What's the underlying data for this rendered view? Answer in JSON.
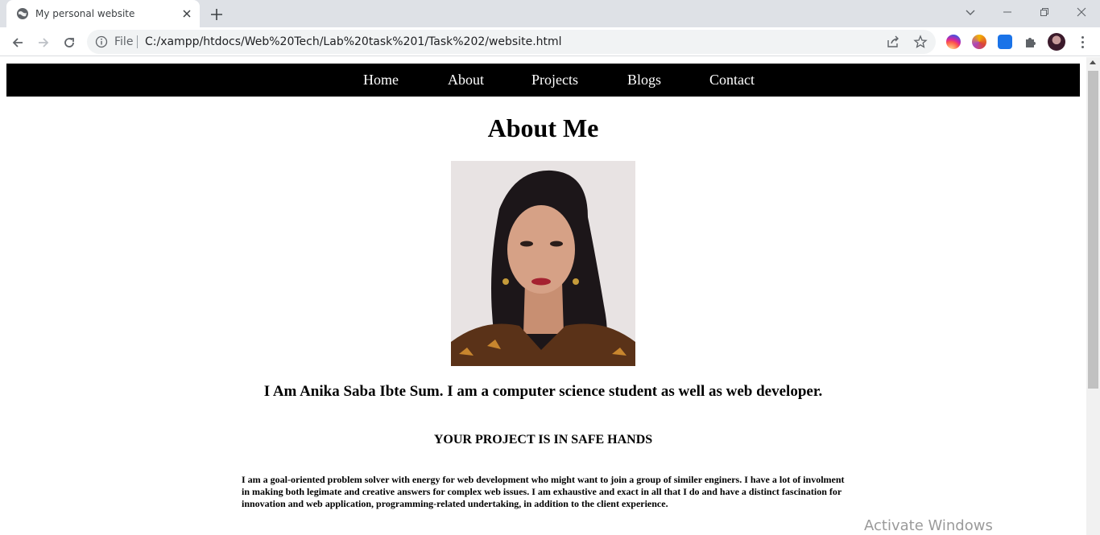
{
  "browser": {
    "tab_title": "My personal website",
    "scheme_label": "File",
    "url": "C:/xampp/htdocs/Web%20Tech/Lab%20task%201/Task%202/website.html"
  },
  "site": {
    "nav": [
      "Home",
      "About",
      "Projects",
      "Blogs",
      "Contact"
    ],
    "heading": "About Me",
    "intro": "I Am Anika Saba Ibte Sum. I am a computer science student as well as web developer.",
    "tagline": "YOUR PROJECT IS IN SAFE HANDS",
    "bio": "I am a goal-oriented problem solver with energy for web development who might want to join a group of similer enginers. I have a lot of involment in making both legimate and creative answers for complex web issues. I am exhaustive and exact in all that I do and have a distinct fascination for innovation and web application, programming-related undertaking, in addition to the client experience."
  },
  "overlay": {
    "watermark": "Activate Windows"
  },
  "icons": {
    "tab_favicon": "globe-icon",
    "toolbar": [
      "back-arrow-icon",
      "forward-arrow-icon",
      "reload-icon",
      "info-icon",
      "share-icon",
      "star-icon",
      "puzzle-icon",
      "kebab-menu-icon"
    ]
  },
  "colors": {
    "nav_background": "#000000",
    "nav_text": "#ffffff",
    "tabstrip": "#dee1e6",
    "omnibox": "#f1f3f4"
  }
}
